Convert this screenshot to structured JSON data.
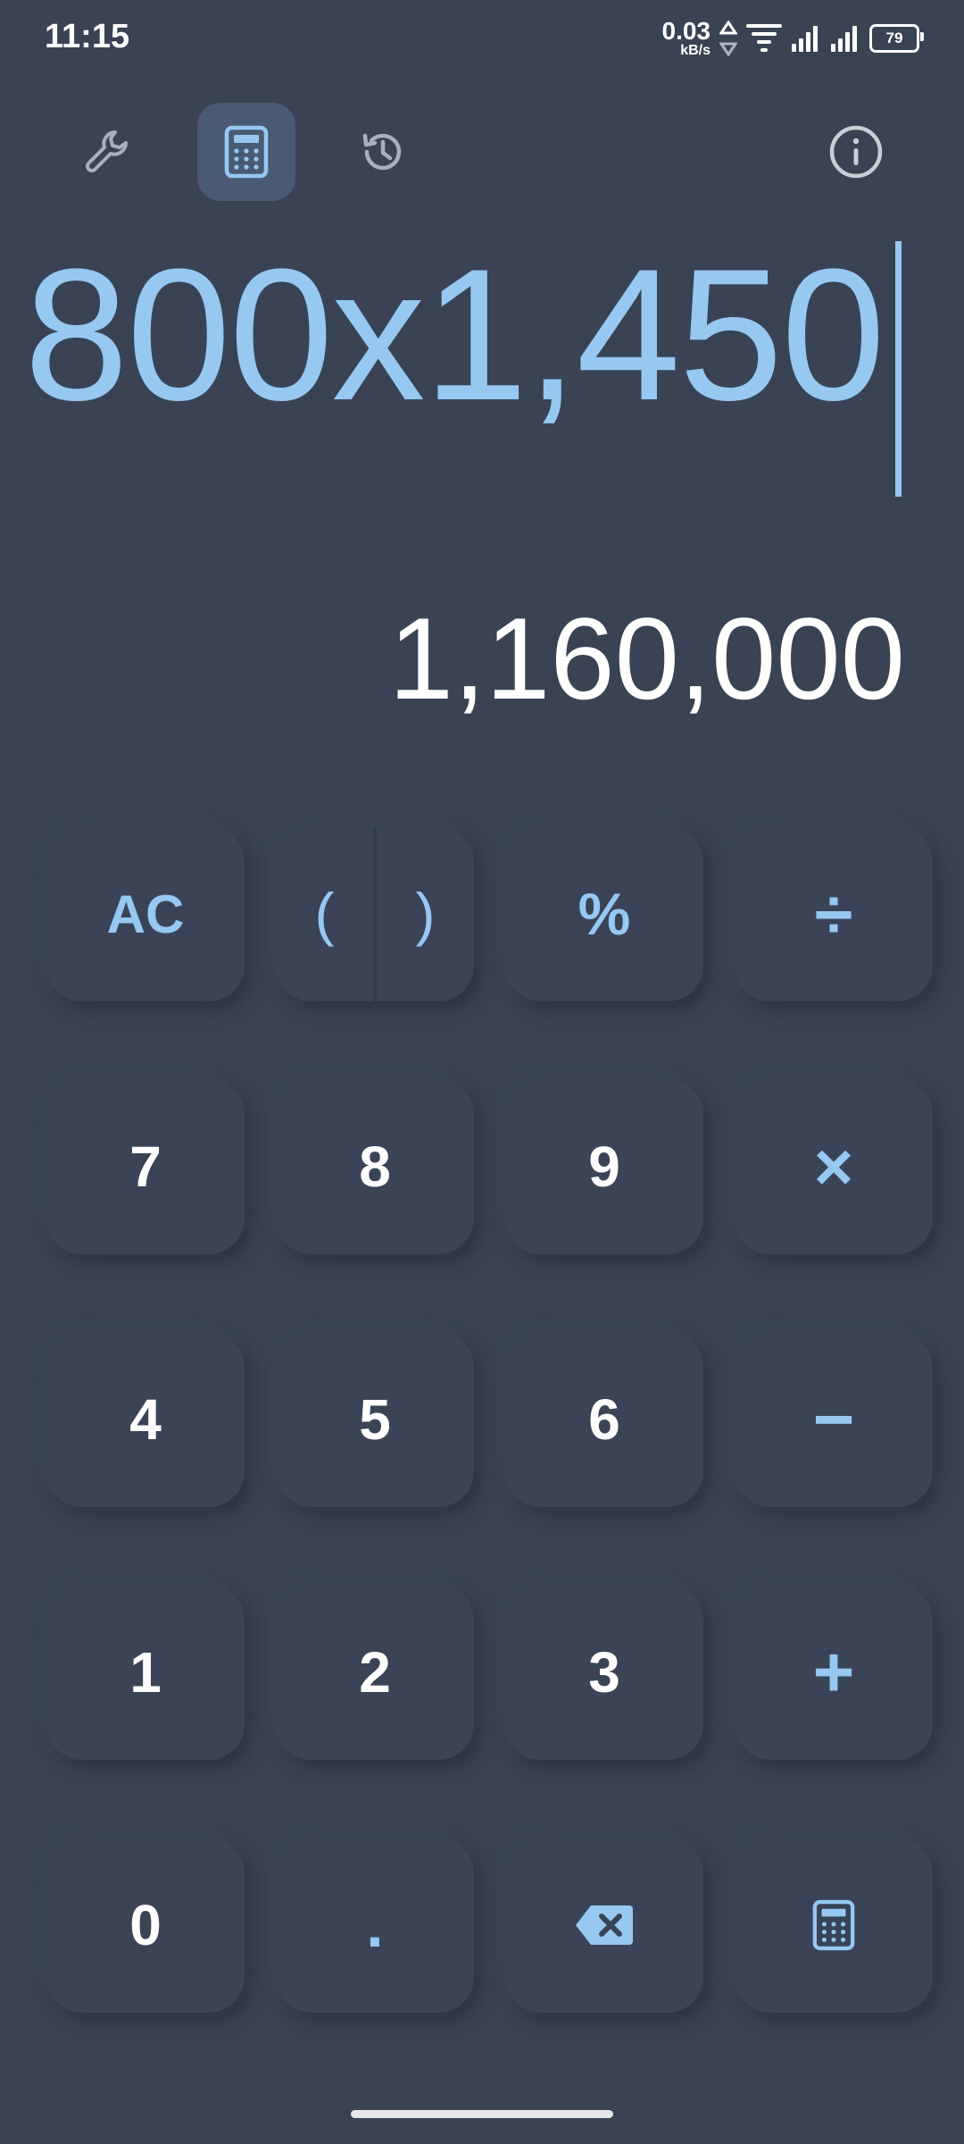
{
  "status_bar": {
    "time": "11:15",
    "net_speed_value": "0.03",
    "net_speed_unit": "kB/s",
    "battery_level": "79"
  },
  "toolbar": {
    "icons": [
      "wrench-icon",
      "calculator-icon",
      "history-icon",
      "info-icon"
    ],
    "active": "calculator-icon"
  },
  "display": {
    "expression": "800x1,450",
    "result": "1,160,000"
  },
  "keypad": {
    "row1": {
      "clear": "AC",
      "open_paren": "(",
      "close_paren": ")",
      "percent": "%",
      "divide": "÷"
    },
    "row2": [
      "7",
      "8",
      "9"
    ],
    "row2_op": "×",
    "row3": [
      "4",
      "5",
      "6"
    ],
    "row3_op": "−",
    "row4": [
      "1",
      "2",
      "3"
    ],
    "row4_op": "+",
    "row5": {
      "zero": "0",
      "decimal": "."
    }
  },
  "colors": {
    "background": "#394354",
    "accent": "#96c8f2",
    "key_face": "#3a4456",
    "text": "#ffffff"
  }
}
